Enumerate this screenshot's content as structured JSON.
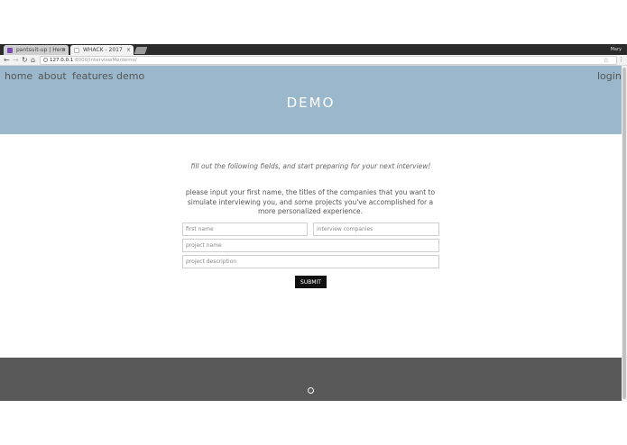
{
  "browser": {
    "tabs": [
      {
        "label": "pantsuit-up | Hero",
        "favicon_color": "#7b4db0"
      },
      {
        "label": "WHACK - 2017",
        "favicon_color": "#ffffff"
      }
    ],
    "user": "Mary",
    "address": {
      "host": "127.0.0.1",
      "path": ":8000/interviewMe/demo/"
    }
  },
  "nav": {
    "home": "home",
    "about": "about",
    "features": "features",
    "demo": "demo",
    "login": "login"
  },
  "hero": {
    "title": "DEMO",
    "bg_color": "#9ab7cb"
  },
  "main": {
    "intro": "fill out the following fields, and start preparing for your next interview!",
    "instructions": "please input your first name, the titles of the companies that you want to simulate interviewing you, and some projects you've accomplished for a more personalized experience.",
    "form": {
      "first_name_placeholder": "first name",
      "companies_placeholder": "interview companies",
      "project_name_placeholder": "project name",
      "project_description_placeholder": "project description",
      "submit_label": "SUBMIT"
    }
  },
  "footer": {
    "bg_color": "#595959",
    "icon": "github-icon"
  }
}
